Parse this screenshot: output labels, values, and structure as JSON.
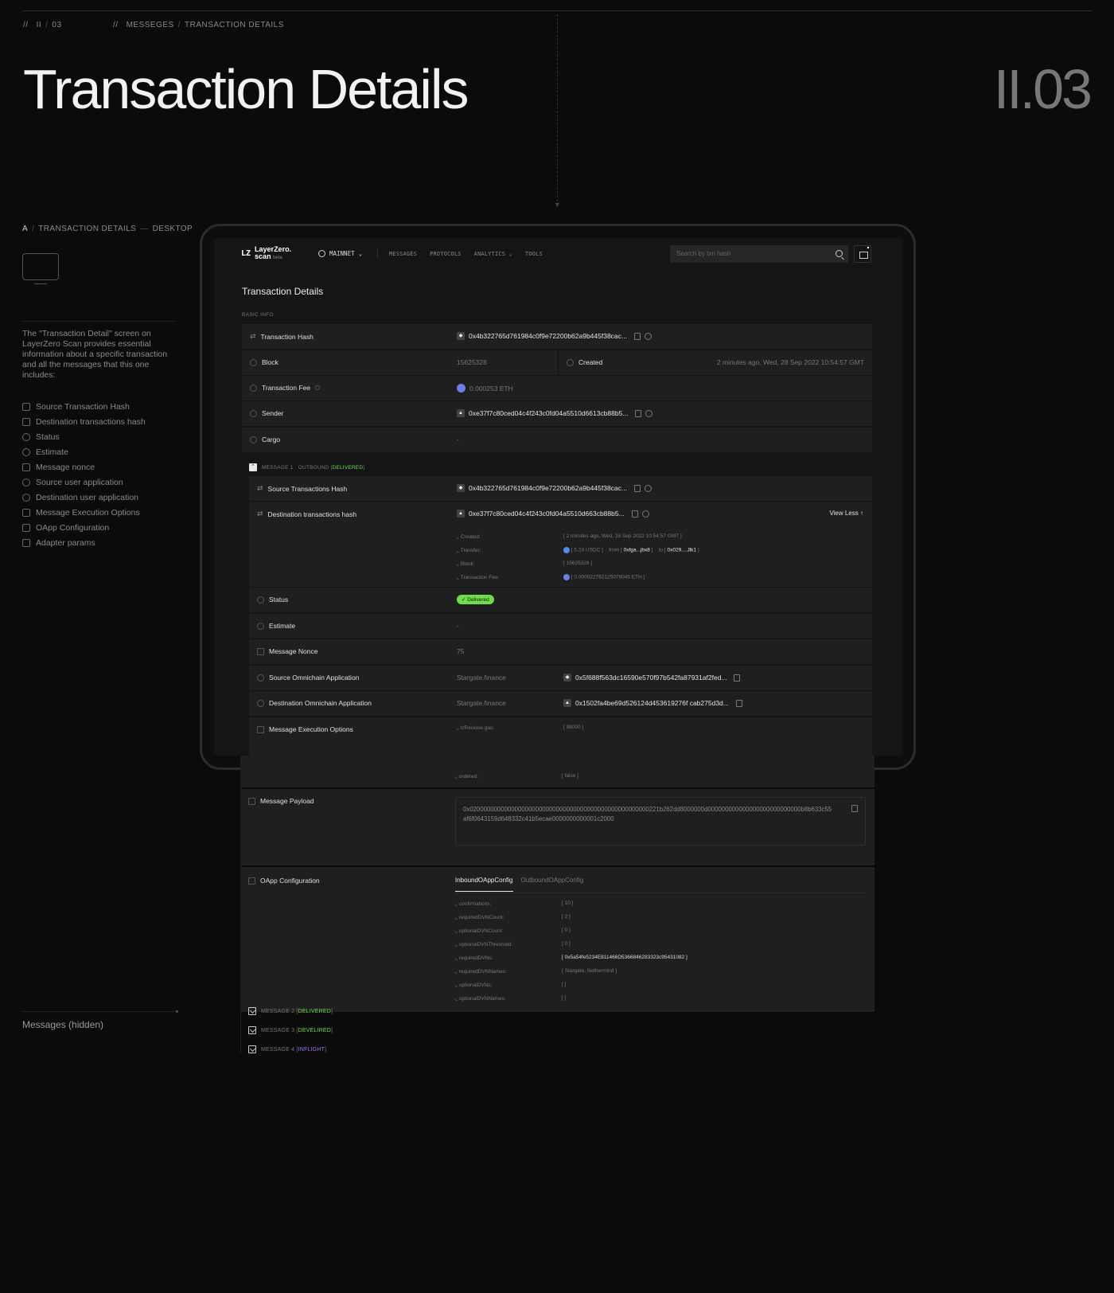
{
  "breadcrumb_left": [
    "//",
    "II",
    "03"
  ],
  "breadcrumb_mid": [
    "//",
    "MESSEGES",
    "TRANSACTION DETAILS"
  ],
  "hero": {
    "title": "Transaction Details",
    "number": "II.03"
  },
  "sidebar": {
    "crumb": {
      "a": "A",
      "sep": "/",
      "page": "TRANSACTION DETAILS",
      "dash": "—",
      "device": "DESKTOP"
    },
    "description": "The \"Transaction Detail\" screen on LayerZero Scan provides essential information about a specific transaction and all the messages that this one includes:",
    "items": [
      {
        "label": "Source Transaction Hash",
        "icon": "swap-icon"
      },
      {
        "label": "Destination transactions hash",
        "icon": "swap-icon"
      },
      {
        "label": "Status",
        "icon": "status-icon"
      },
      {
        "label": "Estimate",
        "icon": "clock-icon"
      },
      {
        "label": "Message nonce",
        "icon": "doc-icon"
      },
      {
        "label": "Source user application",
        "icon": "app-icon"
      },
      {
        "label": "Destination user application",
        "icon": "app-icon"
      },
      {
        "label": "Message Execution Options",
        "icon": "options-icon"
      },
      {
        "label": "OApp Configuration",
        "icon": "options-icon"
      },
      {
        "label": "Adapter params",
        "icon": "options-icon"
      }
    ],
    "hidden_label": "Messages (hidden)"
  },
  "app": {
    "logo_mark": "LZ",
    "logo_name": "LayerZero.",
    "logo_sub": "scan",
    "logo_beta": "beta",
    "network": "MAINNET",
    "nav": [
      "MESSAGES",
      "PROTOCOLS",
      "ANALYTICS",
      "TOOLS"
    ],
    "search_placeholder": "Search by txn hash",
    "title": "Transaction Details",
    "basic_info_label": "BASIC INFO",
    "basic": {
      "tx_hash_label": "Transaction Hash",
      "tx_hash": "0x4b322765d761984c0f9e72200b62a9b445f38cac...",
      "block_label": "Block",
      "block": "15625328",
      "created_label": "Created",
      "created": "2 minutes ago, Wed, 28 Sep 2022 10:54:57 GMT",
      "fee_label": "Transaction Fee",
      "fee": "0.000253 ETH",
      "sender_label": "Sender",
      "sender": "0xe37f7c80ced04c4f243c0fd04a5510d6613cb88b5...",
      "cargo_label": "Cargo",
      "cargo": "-"
    },
    "message1": {
      "head": "MESSAGE 1 · OUTBOUND [",
      "status": "DELIVERED",
      "close": "]",
      "src_hash_label": "Source Transactions Hash",
      "src_hash": "0x4b322765d761984c0f9e72200b62a9b445f38cac...",
      "dst_hash_label": "Destination transactions hash",
      "dst_hash": "0xe37f7c80ced04c4f243c0fd04a5510d663cb88b5...",
      "view_less": "View Less",
      "details": {
        "created_k": "Created:",
        "created_v": "[ 2 minutes ago, Wed, 28 Sep 2022 10:54:57 GMT ]",
        "transfer_k": "Transfer:",
        "transfer_amt": "[ 5.24 USDC ]",
        "transfer_from_k": "from [",
        "transfer_from": "0xfga...jbx8",
        "transfer_to_k": "to [",
        "transfer_to": "0x029....Jlk1",
        "transfer_close": "]",
        "block_k": "Block:",
        "block_v": "[ 15625328 ]",
        "fee_k": "Transaction Fee:",
        "fee_v": "[ 0.000022762125078045 ETH ]"
      },
      "status_label": "Status",
      "status_pill": "✓ Delivered",
      "estimate_label": "Estimate",
      "estimate": "-",
      "nonce_label": "Message Nonce",
      "nonce": "75",
      "src_app_label": "Source Omnichain Application",
      "src_app_name": "Stargate.finance",
      "src_app_addr": "0x5f688f563dc16590e570f97b542fa87931af2fed...",
      "dst_app_label": "Destination Omnichain Application",
      "dst_app_name": "Stargate.finance",
      "dst_app_addr": "0x1502fa4be69d526124d453619276f cab275d3d...",
      "exec_label": "Message Execution Options",
      "exec_gas_k": "lzReceive.gas:",
      "exec_gas_v": "[ 98000 ]",
      "ordered_k": "ordered:",
      "ordered_v": "[ false ]",
      "payload_label": "Message Payload",
      "payload": "0x0200000000000000000000000000000000000000000000000000221b262dd8000000d000000000000000000000000000b8b633c55af6f0643159d648332c41b5ecae0000000000001c2000",
      "oapp_label": "OApp Configuration",
      "tabs": [
        "InboundOAppConfig",
        "OutboundOAppConfig"
      ],
      "config": [
        {
          "k": "confirmations:",
          "v": "[ 10 ]"
        },
        {
          "k": "requiredDVNCount:",
          "v": "[ 2 ]"
        },
        {
          "k": "optionalDVNCount:",
          "v": "[ 0 ]"
        },
        {
          "k": "optionalDVNThreshold:",
          "v": "[ 0 ]"
        },
        {
          "k": "requiredDVNs:",
          "v": "[ 0x5a54fe5234E811466D5366846283323c95431082 ]"
        },
        {
          "k": "requiredDVNNames:",
          "v": "[ Stargate, Nethermind ]"
        },
        {
          "k": "optionalDVNs:",
          "v": "[ ]"
        },
        {
          "k": "optionalDVNNames:",
          "v": "[ ]"
        }
      ]
    },
    "collapsed": [
      {
        "head": "MESSAGE 2 [",
        "status": "DELIVERED",
        "close": "]",
        "color": "#6fdc4e"
      },
      {
        "head": "MESSAGE 3 [",
        "status": "DEVELIRED",
        "close": "]",
        "color": "#6fdc4e"
      },
      {
        "head": "MESSAGE 4 [",
        "status": "INFLIGHT",
        "close": "]",
        "color": "#a371f7"
      }
    ]
  }
}
